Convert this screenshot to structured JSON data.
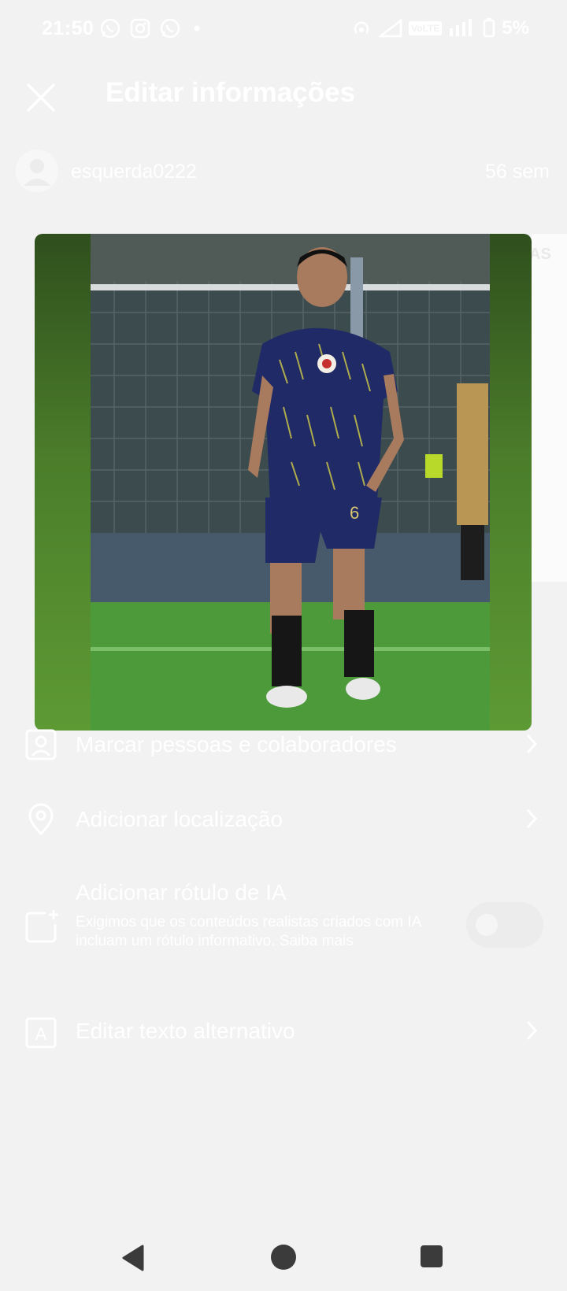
{
  "status_bar": {
    "time": "21:50",
    "left_icons": [
      "whatsapp-icon",
      "instagram-icon",
      "whatsapp-icon",
      "dot-icon"
    ],
    "volte_label": "VoLTE",
    "battery_text": "5%"
  },
  "header": {
    "title": "Editar informações",
    "close_icon": "close-icon"
  },
  "post": {
    "username": "esquerda0222",
    "time_ago": "56 sem",
    "peek_text": "AS",
    "photo_subject": "soccer player in navy kit number 6"
  },
  "menu": {
    "tag_people": "Marcar pessoas e colaboradores",
    "add_location": "Adicionar localização",
    "ai_label": {
      "title": "Adicionar rótulo de IA",
      "description": "Exigimos que os conteúdos realistas criados com IA incluam um rótulo informativo. Saiba mais",
      "enabled": false
    },
    "alt_text": "Editar texto alternativo"
  },
  "colors": {
    "background": "#f2f2f3",
    "text": "#ffffff",
    "nav_icons": "#3b3b3b",
    "media_green": "#4b7d2a"
  }
}
